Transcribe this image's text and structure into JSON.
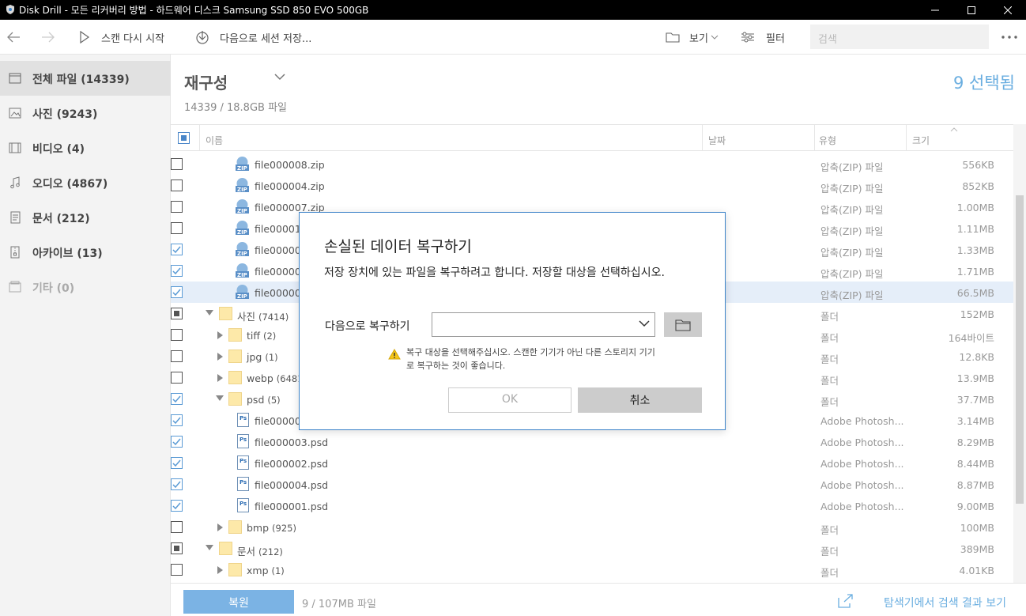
{
  "window": {
    "title": "Disk Drill - 모든 리커버리 방법 - 하드웨어 디스크 Samsung SSD 850 EVO 500GB"
  },
  "toolbar": {
    "scan_again": "스캔 다시 시작",
    "save_session": "다음으로 세션 저장...",
    "view": "보기",
    "filter": "필터",
    "search_placeholder": "검색"
  },
  "sidebar": {
    "items": [
      {
        "label": "전체 파일 (14339)",
        "icon": "all-files-icon"
      },
      {
        "label": "사진 (9243)",
        "icon": "picture-icon"
      },
      {
        "label": "비디오 (4)",
        "icon": "video-icon"
      },
      {
        "label": "오디오 (4867)",
        "icon": "audio-icon"
      },
      {
        "label": "문서 (212)",
        "icon": "document-icon"
      },
      {
        "label": "아카이브 (13)",
        "icon": "archive-icon"
      },
      {
        "label": "기타 (0)",
        "icon": "other-icon"
      }
    ]
  },
  "header": {
    "title": "재구성",
    "subtitle": "14339 / 18.8GB 파일",
    "selected": "9 선택됨"
  },
  "columns": {
    "name": "이름",
    "date": "날짜",
    "type": "유형",
    "size": "크기"
  },
  "rows": [
    {
      "name": "file000008.zip",
      "type": "압축(ZIP) 파일",
      "size": "556KB"
    },
    {
      "name": "file000004.zip",
      "type": "압축(ZIP) 파일",
      "size": "852KB"
    },
    {
      "name": "file000007.zip",
      "type": "압축(ZIP) 파일",
      "size": "1.00MB"
    },
    {
      "name": "file00001",
      "type": "압축(ZIP) 파일",
      "size": "1.11MB"
    },
    {
      "name": "file00000",
      "type": "압축(ZIP) 파일",
      "size": "1.33MB"
    },
    {
      "name": "file00000",
      "type": "압축(ZIP) 파일",
      "size": "1.71MB"
    },
    {
      "name": "file00000",
      "type": "압축(ZIP) 파일",
      "size": "66.5MB"
    },
    {
      "name": "사진",
      "count": "(7414)",
      "type": "폴더",
      "size": "152MB"
    },
    {
      "name": "tiff",
      "count": "(2)",
      "type": "폴더",
      "size": "164바이트"
    },
    {
      "name": "jpg",
      "count": "(1)",
      "type": "폴더",
      "size": "12.8KB"
    },
    {
      "name": "webp",
      "count": "(6481",
      "type": "폴더",
      "size": "13.9MB"
    },
    {
      "name": "psd",
      "count": "(5)",
      "type": "폴더",
      "size": "37.7MB"
    },
    {
      "name": "file00000",
      "type": "Adobe Photosh...",
      "size": "3.14MB"
    },
    {
      "name": "file000003.psd",
      "type": "Adobe Photosh...",
      "size": "8.29MB"
    },
    {
      "name": "file000002.psd",
      "type": "Adobe Photosh...",
      "size": "8.44MB"
    },
    {
      "name": "file000004.psd",
      "type": "Adobe Photosh...",
      "size": "8.87MB"
    },
    {
      "name": "file000001.psd",
      "type": "Adobe Photosh...",
      "size": "9.00MB"
    },
    {
      "name": "bmp",
      "count": "(925)",
      "type": "폴더",
      "size": "100MB"
    },
    {
      "name": "문서",
      "count": "(212)",
      "type": "폴더",
      "size": "389MB"
    },
    {
      "name": "xmp",
      "count": "(1)",
      "type": "폴더",
      "size": "4.01KB"
    }
  ],
  "footer": {
    "restore": "복원",
    "info": "9 / 107MB 파일",
    "explorer_link": "탐색기에서 검색 결과 보기"
  },
  "dialog": {
    "title": "손실된 데이터 복구하기",
    "message": "저장 장치에 있는 파일을 복구하려고 합니다. 저장할 대상을 선택하십시오.",
    "label": "다음으로 복구하기",
    "warning": "복구 대상을 선택해주십시오. 스캔한 기기가 아닌 다른 스토리지 기기로 복구하는 것이 좋습니다.",
    "ok": "OK",
    "cancel": "취소"
  },
  "colors": {
    "accent": "#6aaee0",
    "dialog_border": "#3c83c9",
    "restore_button": "#7bb3e4"
  }
}
